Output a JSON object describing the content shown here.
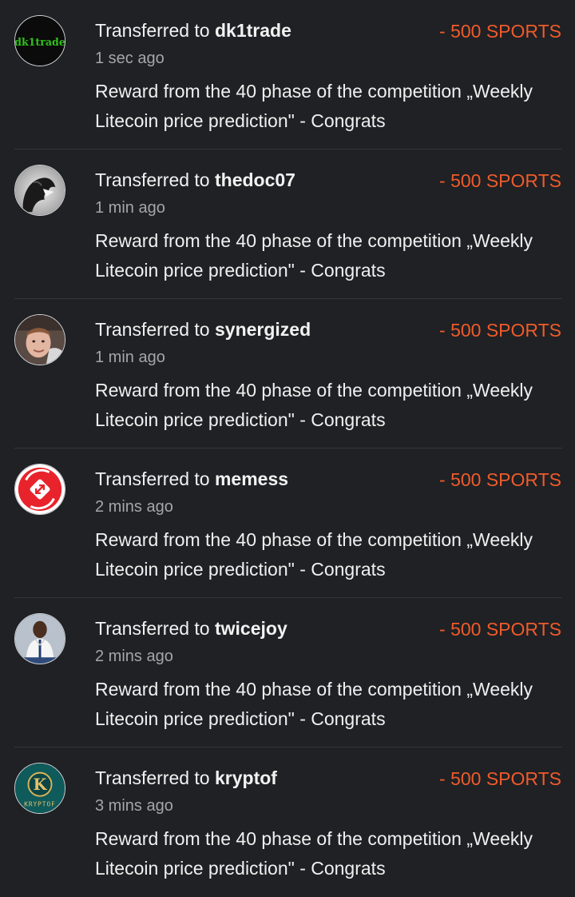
{
  "transfers": [
    {
      "prefix": "Transferred to",
      "username": "dk1trade",
      "amount": "- 500 SPORTS",
      "time": "1 sec ago",
      "memo": "Reward from the 40 phase of the competition „Weekly Litecoin price prediction\" - Congrats",
      "avatar_text": "dk1trade"
    },
    {
      "prefix": "Transferred to",
      "username": "thedoc07",
      "amount": "- 500 SPORTS",
      "time": "1 min ago",
      "memo": "Reward from the 40 phase of the competition „Weekly Litecoin price prediction\" - Congrats"
    },
    {
      "prefix": "Transferred to",
      "username": "synergized",
      "amount": "- 500 SPORTS",
      "time": "1 min ago",
      "memo": "Reward from the 40 phase of the competition „Weekly Litecoin price prediction\" - Congrats"
    },
    {
      "prefix": "Transferred to",
      "username": "memess",
      "amount": "- 500 SPORTS",
      "time": "2 mins ago",
      "memo": "Reward from the 40 phase of the competition „Weekly Litecoin price prediction\" - Congrats"
    },
    {
      "prefix": "Transferred to",
      "username": "twicejoy",
      "amount": "- 500 SPORTS",
      "time": "2 mins ago",
      "memo": "Reward from the 40 phase of the competition „Weekly Litecoin price prediction\" - Congrats"
    },
    {
      "prefix": "Transferred to",
      "username": "kryptof",
      "amount": "- 500 SPORTS",
      "time": "3 mins ago",
      "memo": "Reward from the 40 phase of the competition „Weekly Litecoin price prediction\" - Congrats",
      "avatar_text": "K",
      "avatar_caption": "KRYPTOF"
    }
  ],
  "colors": {
    "background": "#1f2124",
    "amount": "#ef5b2b",
    "muted": "#a3a6aa",
    "divider": "#33363a"
  }
}
